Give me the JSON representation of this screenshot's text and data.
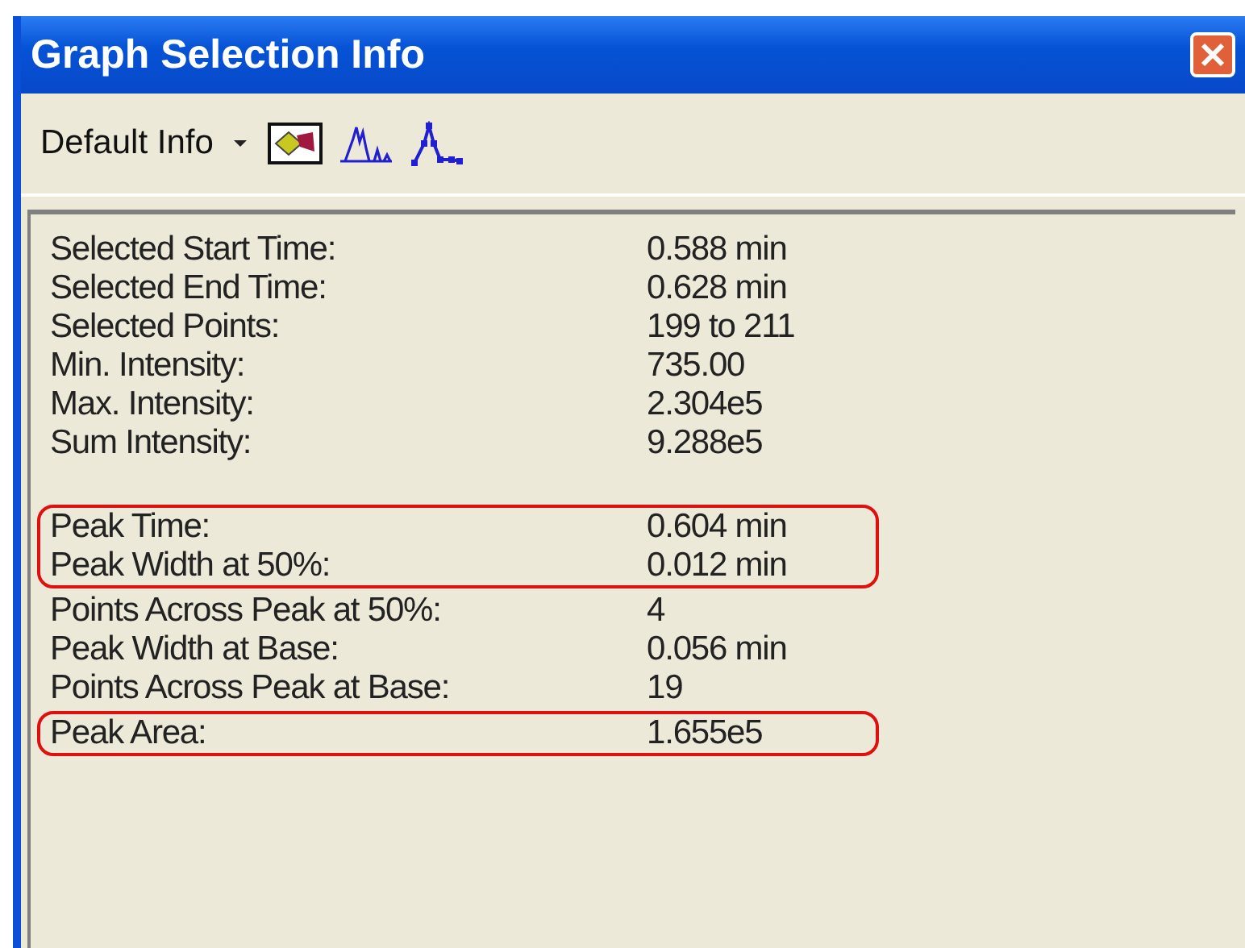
{
  "window": {
    "title": "Graph Selection Info"
  },
  "toolbar": {
    "view_menu": "Default Info"
  },
  "sections": [
    {
      "blocks": [
        {
          "highlighted": false,
          "rows": [
            {
              "label": "Selected Start Time:",
              "value": "0.588 min"
            },
            {
              "label": "Selected End Time:",
              "value": "0.628 min"
            },
            {
              "label": "Selected Points:",
              "value": "199 to 211"
            },
            {
              "label": "Min. Intensity:",
              "value": "735.00"
            },
            {
              "label": "Max. Intensity:",
              "value": "2.304e5"
            },
            {
              "label": "Sum Intensity:",
              "value": "9.288e5"
            }
          ]
        }
      ]
    },
    {
      "blocks": [
        {
          "highlighted": true,
          "rows": [
            {
              "label": "Peak Time:",
              "value": "0.604 min"
            },
            {
              "label": "Peak Width at 50%:",
              "value": "0.012 min"
            }
          ]
        },
        {
          "highlighted": false,
          "rows": [
            {
              "label": "Points Across Peak at 50%:",
              "value": "4"
            },
            {
              "label": "Peak Width at Base:",
              "value": "0.056 min"
            },
            {
              "label": "Points Across Peak at Base:",
              "value": "19"
            }
          ]
        },
        {
          "highlighted": true,
          "rows": [
            {
              "label": "Peak Area:",
              "value": "1.655e5"
            }
          ]
        }
      ]
    }
  ]
}
